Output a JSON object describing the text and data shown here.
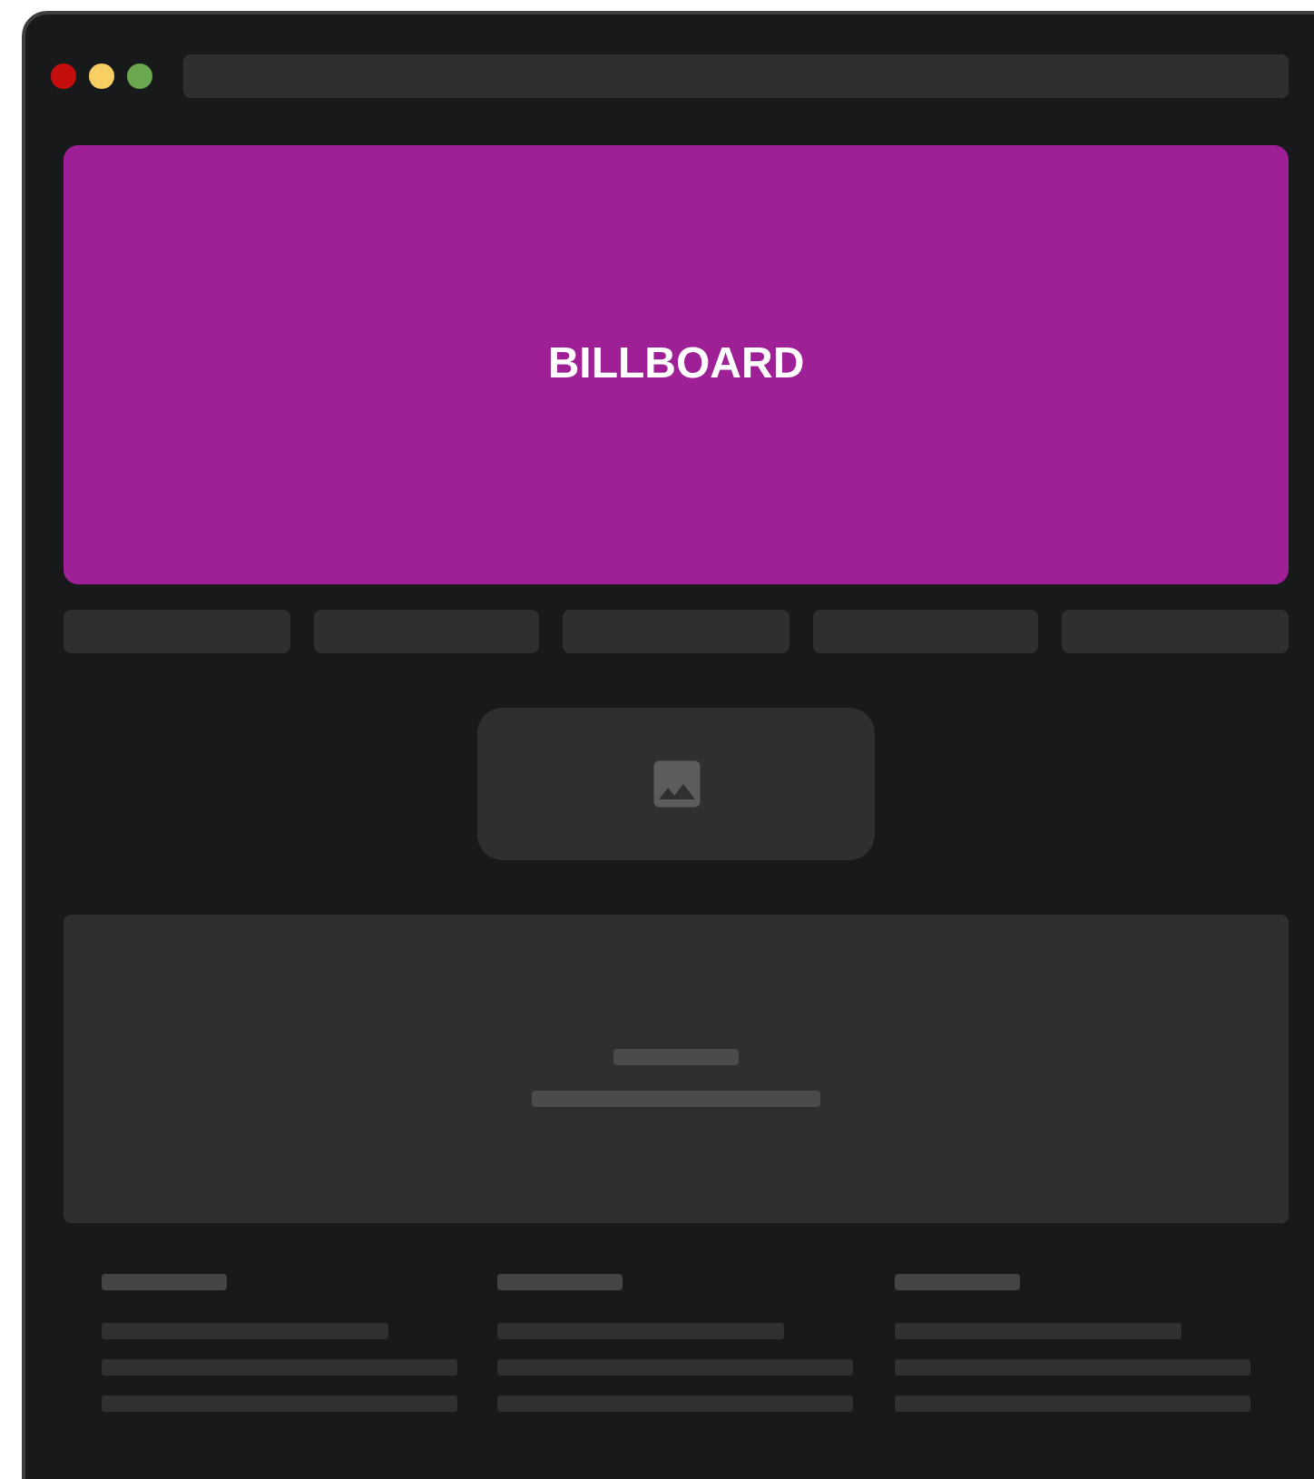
{
  "billboard": {
    "label": "BILLBOARD"
  }
}
